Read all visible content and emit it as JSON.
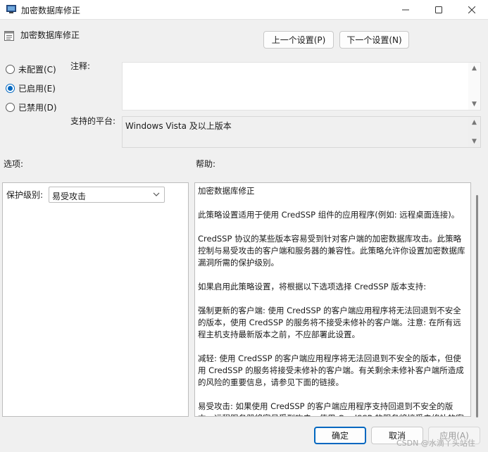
{
  "window": {
    "title": "加密数据库修正",
    "controls": {
      "minimize_icon": "minimize-icon",
      "maximize_icon": "maximize-icon",
      "close_icon": "close-icon"
    }
  },
  "header": {
    "icon": "policy-icon",
    "title": "加密数据库修正"
  },
  "nav": {
    "prev_label": "上一个设置(P)",
    "next_label": "下一个设置(N)"
  },
  "state": {
    "options": [
      {
        "label": "未配置(C)",
        "checked": false
      },
      {
        "label": "已启用(E)",
        "checked": true
      },
      {
        "label": "已禁用(D)",
        "checked": false
      }
    ]
  },
  "comment": {
    "label": "注释:",
    "value": ""
  },
  "platform": {
    "label": "支持的平台:",
    "value": "Windows Vista 及以上版本"
  },
  "options_section": {
    "label": "选项:",
    "protection_label": "保护级别:",
    "protection_value": "易受攻击"
  },
  "help_section": {
    "label": "帮助:",
    "paragraphs": [
      "加密数据库修正",
      "此策略设置适用于使用 CredSSP 组件的应用程序(例如: 远程桌面连接)。",
      "CredSSP 协议的某些版本容易受到针对客户端的加密数据库攻击。此策略控制与易受攻击的客户端和服务器的兼容性。此策略允许你设置加密数据库漏洞所需的保护级别。",
      "如果启用此策略设置，将根据以下选项选择 CredSSP 版本支持:",
      "强制更新的客户端: 使用 CredSSP 的客户端应用程序将无法回退到不安全的版本，使用 CredSSP 的服务将不接受未修补的客户端。注意: 在所有远程主机支持最新版本之前，不应部署此设置。",
      "减轻: 使用 CredSSP 的客户端应用程序将无法回退到不安全的版本，但使用 CredSSP 的服务将接受未修补的客户端。有关剩余未修补客户端所造成的风险的重要信息，请参见下面的链接。",
      "易受攻击: 如果使用 CredSSP 的客户端应用程序支持回退到不安全的版本，远程服务器将容易受到攻击。使用 CredSSP 的服务将接受未修补的客户端。"
    ]
  },
  "footer": {
    "ok_label": "确定",
    "cancel_label": "取消",
    "apply_label": "应用(A)"
  },
  "watermark": "CSDN @水滴丫头站住",
  "colors": {
    "accent": "#0067c0",
    "window_bg": "#f0f0f0"
  }
}
